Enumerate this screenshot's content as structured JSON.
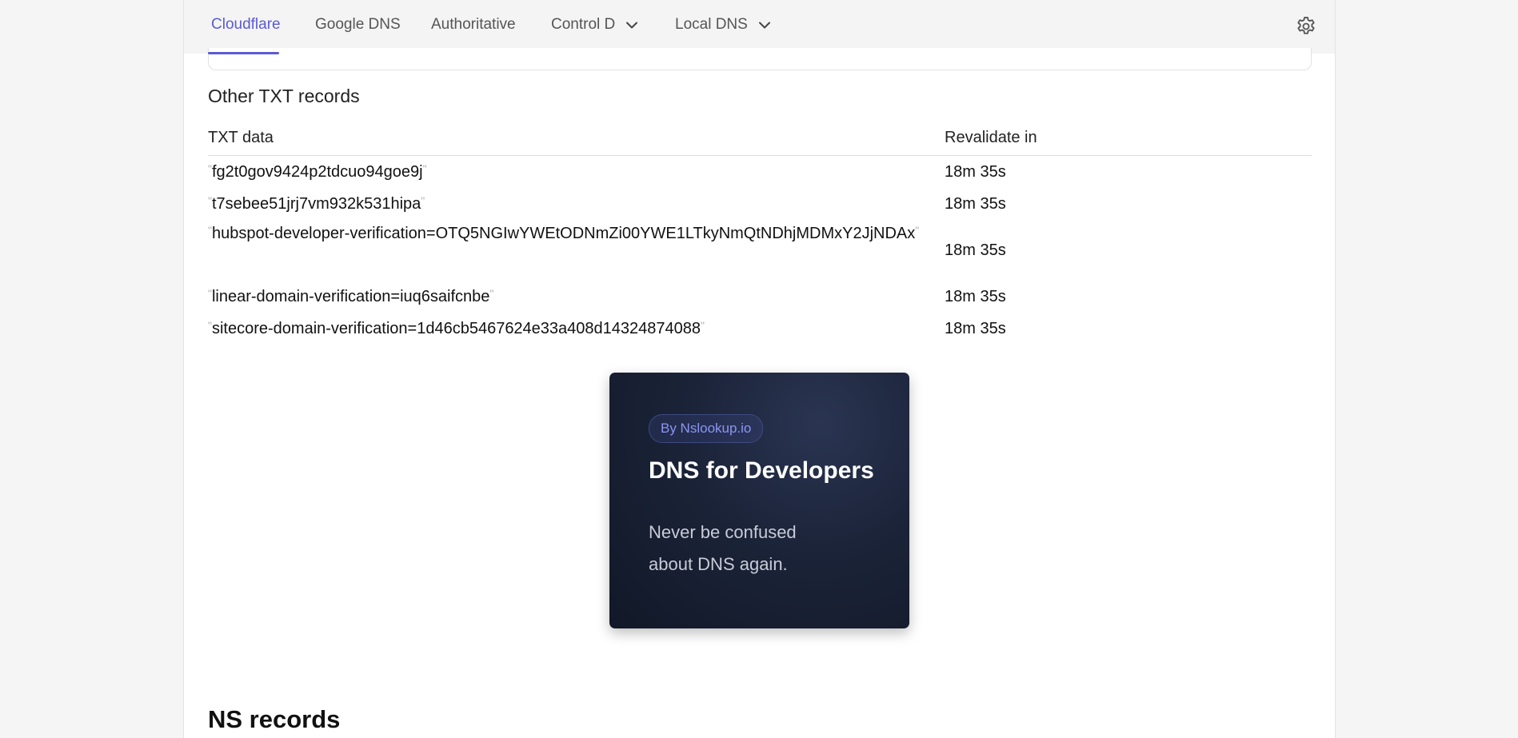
{
  "nav": {
    "tabs": [
      {
        "label": "Cloudflare",
        "active": true
      },
      {
        "label": "Google DNS"
      },
      {
        "label": "Authoritative"
      },
      {
        "label": "Control D",
        "has_dropdown": true
      },
      {
        "label": "Local DNS",
        "has_dropdown": true
      }
    ],
    "settings_icon": "gear-icon",
    "accent_color": "#5b5bd6"
  },
  "txt_section": {
    "title": "Other TXT records",
    "columns": [
      "TXT data",
      "Revalidate in"
    ],
    "rows": [
      {
        "data": "fg2t0gov9424p2tdcuo94goe9j",
        "ttl": "18m 35s"
      },
      {
        "data": "t7sebee51jrj7vm932k531hipa",
        "ttl": "18m 35s"
      },
      {
        "data": "hubspot-developer-verification=OTQ5NGIwYWEtODNmZi00YWE1LTkyNmQtNDhjMDMxY2JjNDAx",
        "ttl": "18m 35s"
      },
      {
        "data": "linear-domain-verification=iuq6saifcnbe",
        "ttl": "18m 35s"
      },
      {
        "data": "sitecore-domain-verification=1d46cb5467624e33a408d14324874088",
        "ttl": "18m 35s"
      }
    ]
  },
  "promo": {
    "badge": "By Nslookup.io",
    "title": "DNS for Developers",
    "subtitle_line1": "Never be confused",
    "subtitle_line2": "about DNS again."
  },
  "ns_section": {
    "title": "NS records"
  }
}
